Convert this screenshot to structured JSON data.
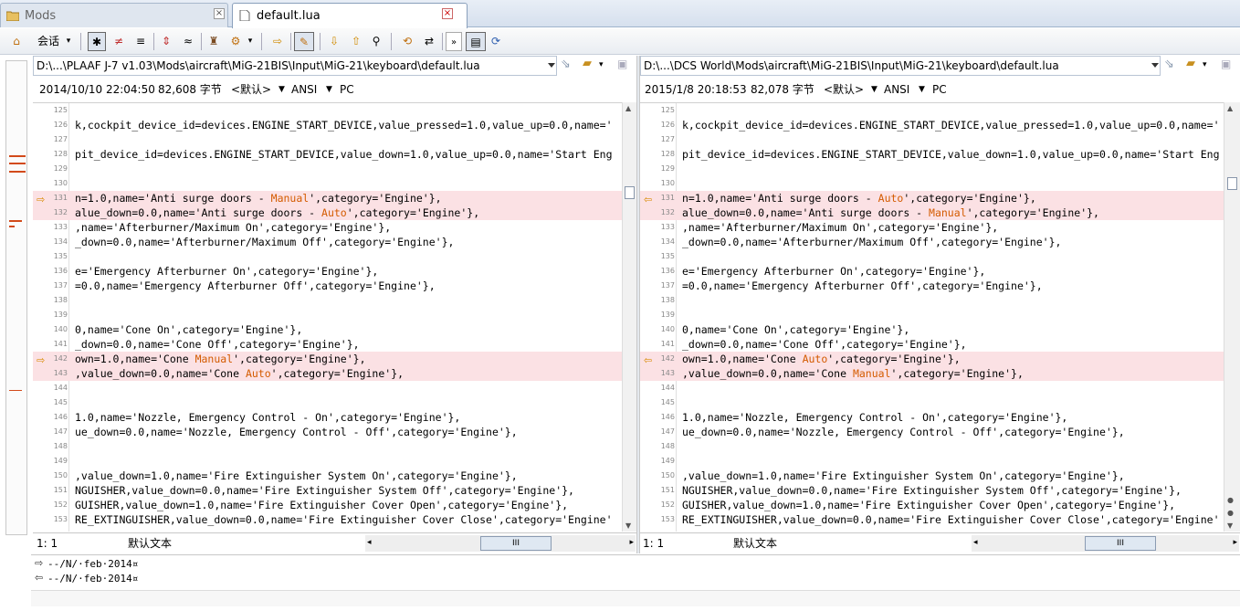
{
  "tabs": [
    {
      "label": "Mods",
      "active": false
    },
    {
      "label": "default.lua",
      "active": true
    }
  ],
  "toolbar": {
    "session_label": "会话",
    "buttons": [
      "home-icon",
      "session-menu",
      "show-all-icon",
      "show-diffs-icon",
      "show-same-icon",
      "context-icon",
      "ignore-icon",
      "rules-icon",
      "format-icon",
      "next-diff-icon",
      "edit-icon",
      "prev-icon",
      "next-icon",
      "find-icon",
      "swap-icon",
      "sync-icon",
      "nav-icon",
      "columns-icon",
      "refresh-icon"
    ]
  },
  "left": {
    "path": "D:\\...\\PLAAF J-7 v1.03\\Mods\\aircraft\\MiG-21BIS\\Input\\MiG-21\\keyboard\\default.lua",
    "date": "2014/10/10 22:04:50",
    "size": "82,608 字节",
    "format": "<默认>",
    "encoding": "ANSI",
    "lineend": "PC",
    "cursor": "1: 1",
    "mode": "默认文本",
    "lines": [
      {
        "n": "125",
        "t": "",
        "diff": false
      },
      {
        "n": "126",
        "t": "k,cockpit_device_id=devices.ENGINE_START_DEVICE,value_pressed=1.0,value_up=0.0,name='",
        "diff": false
      },
      {
        "n": "127",
        "t": "",
        "diff": false
      },
      {
        "n": "128",
        "t": "pit_device_id=devices.ENGINE_START_DEVICE,value_down=1.0,value_up=0.0,name='Start Eng",
        "diff": false
      },
      {
        "n": "129",
        "t": "",
        "diff": false
      },
      {
        "n": "130",
        "t": "",
        "diff": false
      },
      {
        "n": "131",
        "t": "n=1.0,name='Anti surge doors - ",
        "hl": "Manual",
        "t2": "',category='Engine'},",
        "diff": true,
        "arrow": true
      },
      {
        "n": "132",
        "t": "alue_down=0.0,name='Anti surge doors - ",
        "hl": "Auto",
        "t2": "',category='Engine'},",
        "diff": true
      },
      {
        "n": "133",
        "t": ",name='Afterburner/Maximum On',category='Engine'},",
        "diff": false
      },
      {
        "n": "134",
        "t": "_down=0.0,name='Afterburner/Maximum Off',category='Engine'},",
        "diff": false
      },
      {
        "n": "135",
        "t": "",
        "diff": false
      },
      {
        "n": "136",
        "t": "e='Emergency Afterburner On',category='Engine'},",
        "diff": false
      },
      {
        "n": "137",
        "t": "=0.0,name='Emergency Afterburner Off',category='Engine'},",
        "diff": false
      },
      {
        "n": "138",
        "t": "",
        "diff": false
      },
      {
        "n": "139",
        "t": "",
        "diff": false
      },
      {
        "n": "140",
        "t": "0,name='Cone On',category='Engine'},",
        "diff": false
      },
      {
        "n": "141",
        "t": "_down=0.0,name='Cone Off',category='Engine'},",
        "diff": false
      },
      {
        "n": "142",
        "t": "own=1.0,name='Cone ",
        "hl": "Manual",
        "t2": "',category='Engine'},",
        "diff": true,
        "arrow": true
      },
      {
        "n": "143",
        "t": ",value_down=0.0,name='Cone ",
        "hl": "Auto",
        "t2": "',category='Engine'},",
        "diff": true
      },
      {
        "n": "144",
        "t": "",
        "diff": false
      },
      {
        "n": "145",
        "t": "",
        "diff": false
      },
      {
        "n": "146",
        "t": "1.0,name='Nozzle, Emergency Control - On',category='Engine'},",
        "diff": false
      },
      {
        "n": "147",
        "t": "ue_down=0.0,name='Nozzle, Emergency Control - Off',category='Engine'},",
        "diff": false
      },
      {
        "n": "148",
        "t": "",
        "diff": false
      },
      {
        "n": "149",
        "t": "",
        "diff": false
      },
      {
        "n": "150",
        "t": ",value_down=1.0,name='Fire Extinguisher System On',category='Engine'},",
        "diff": false
      },
      {
        "n": "151",
        "t": "NGUISHER,value_down=0.0,name='Fire Extinguisher System Off',category='Engine'},",
        "diff": false
      },
      {
        "n": "152",
        "t": "GUISHER,value_down=1.0,name='Fire Extinguisher Cover Open',category='Engine'},",
        "diff": false
      },
      {
        "n": "153",
        "t": "RE_EXTINGUISHER,value_down=0.0,name='Fire Extinguisher Cover Close',category='Engine'",
        "diff": false
      }
    ]
  },
  "right": {
    "path": "D:\\...\\DCS World\\Mods\\aircraft\\MiG-21BIS\\Input\\MiG-21\\keyboard\\default.lua",
    "date": "2015/1/8 20:18:53",
    "size": "82,078 字节",
    "format": "<默认>",
    "encoding": "ANSI",
    "lineend": "PC",
    "cursor": "1: 1",
    "mode": "默认文本",
    "lines": [
      {
        "n": "125",
        "t": "",
        "diff": false
      },
      {
        "n": "126",
        "t": "k,cockpit_device_id=devices.ENGINE_START_DEVICE,value_pressed=1.0,value_up=0.0,name='",
        "diff": false
      },
      {
        "n": "127",
        "t": "",
        "diff": false
      },
      {
        "n": "128",
        "t": "pit_device_id=devices.ENGINE_START_DEVICE,value_down=1.0,value_up=0.0,name='Start Eng",
        "diff": false
      },
      {
        "n": "129",
        "t": "",
        "diff": false
      },
      {
        "n": "130",
        "t": "",
        "diff": false
      },
      {
        "n": "131",
        "t": "n=1.0,name='Anti surge doors - ",
        "hl": "Auto",
        "t2": "',category='Engine'},",
        "diff": true,
        "arrow": true
      },
      {
        "n": "132",
        "t": "alue_down=0.0,name='Anti surge doors - ",
        "hl": "Manual",
        "t2": "',category='Engine'},",
        "diff": true
      },
      {
        "n": "133",
        "t": ",name='Afterburner/Maximum On',category='Engine'},",
        "diff": false
      },
      {
        "n": "134",
        "t": "_down=0.0,name='Afterburner/Maximum Off',category='Engine'},",
        "diff": false
      },
      {
        "n": "135",
        "t": "",
        "diff": false
      },
      {
        "n": "136",
        "t": "e='Emergency Afterburner On',category='Engine'},",
        "diff": false
      },
      {
        "n": "137",
        "t": "=0.0,name='Emergency Afterburner Off',category='Engine'},",
        "diff": false
      },
      {
        "n": "138",
        "t": "",
        "diff": false
      },
      {
        "n": "139",
        "t": "",
        "diff": false
      },
      {
        "n": "140",
        "t": "0,name='Cone On',category='Engine'},",
        "diff": false
      },
      {
        "n": "141",
        "t": "_down=0.0,name='Cone Off',category='Engine'},",
        "diff": false
      },
      {
        "n": "142",
        "t": "own=1.0,name='Cone ",
        "hl": "Auto",
        "t2": "',category='Engine'},",
        "diff": true,
        "arrow": true
      },
      {
        "n": "143",
        "t": ",value_down=0.0,name='Cone ",
        "hl": "Manual",
        "t2": "',category='Engine'},",
        "diff": true
      },
      {
        "n": "144",
        "t": "",
        "diff": false
      },
      {
        "n": "145",
        "t": "",
        "diff": false
      },
      {
        "n": "146",
        "t": "1.0,name='Nozzle, Emergency Control - On',category='Engine'},",
        "diff": false
      },
      {
        "n": "147",
        "t": "ue_down=0.0,name='Nozzle, Emergency Control - Off',category='Engine'},",
        "diff": false
      },
      {
        "n": "148",
        "t": "",
        "diff": false
      },
      {
        "n": "149",
        "t": "",
        "diff": false
      },
      {
        "n": "150",
        "t": ",value_down=1.0,name='Fire Extinguisher System On',category='Engine'},",
        "diff": false
      },
      {
        "n": "151",
        "t": "NGUISHER,value_down=0.0,name='Fire Extinguisher System Off',category='Engine'},",
        "diff": false
      },
      {
        "n": "152",
        "t": "GUISHER,value_down=1.0,name='Fire Extinguisher Cover Open',category='Engine'},",
        "diff": false
      },
      {
        "n": "153",
        "t": "RE_EXTINGUISHER,value_down=0.0,name='Fire Extinguisher Cover Close',category='Engine'",
        "diff": false
      }
    ]
  },
  "bottom": {
    "line1": "--/N/·feb·2014¤",
    "line2": "--/N/·feb·2014¤"
  },
  "colors": {
    "diff_bg": "#fbe1e4",
    "highlight_text": "#d45b00",
    "arrow": "#d88a00"
  }
}
